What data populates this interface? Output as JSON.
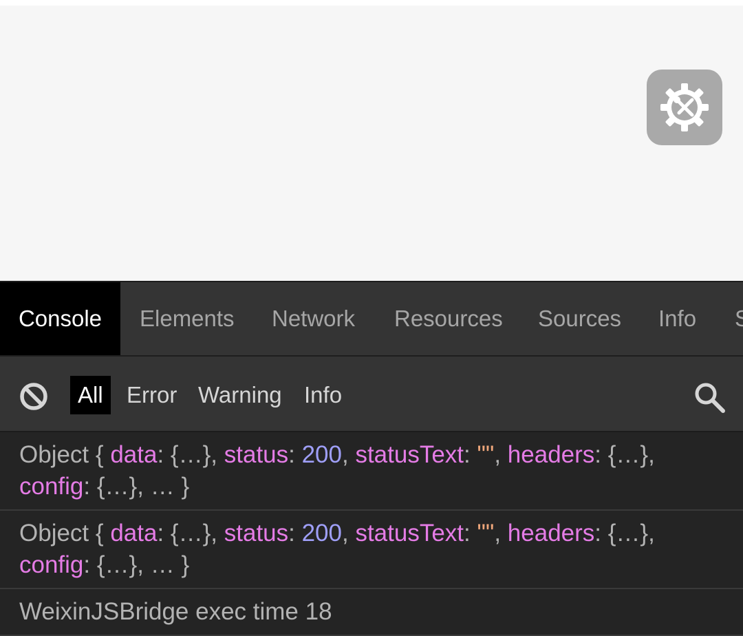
{
  "fab": {
    "icon": "settings-tools-icon",
    "color": "#a9a9a9"
  },
  "tabs": [
    {
      "label": "Console",
      "active": true
    },
    {
      "label": "Elements"
    },
    {
      "label": "Network"
    },
    {
      "label": "Resources"
    },
    {
      "label": "Sources"
    },
    {
      "label": "Info"
    },
    {
      "label": "S"
    }
  ],
  "toolbar": {
    "clear_icon": "clear-icon",
    "filters": [
      "All",
      "Error",
      "Warning",
      "Info"
    ],
    "active_filter": "All",
    "search_icon": "search-icon"
  },
  "logs": [
    {
      "object_label": "Object",
      "open_brace": "{",
      "pairs": [
        {
          "key": "data",
          "value": "{…}"
        },
        {
          "key": "status",
          "value": "200"
        },
        {
          "key": "statusText",
          "value": "\"\""
        },
        {
          "key": "headers",
          "value": "{…}"
        },
        {
          "key": "config",
          "value": "{…}"
        }
      ],
      "ellipsis": "…",
      "close_brace": "}"
    },
    {
      "object_label": "Object",
      "open_brace": "{",
      "pairs": [
        {
          "key": "data",
          "value": "{…}"
        },
        {
          "key": "status",
          "value": "200"
        },
        {
          "key": "statusText",
          "value": "\"\""
        },
        {
          "key": "headers",
          "value": "{…}"
        },
        {
          "key": "config",
          "value": "{…}"
        }
      ],
      "ellipsis": "…",
      "close_brace": "}"
    },
    {
      "text": "WeixinJSBridge exec time 18"
    }
  ],
  "colors": {
    "key": "#e57ce6",
    "number": "#9f9ff8",
    "string": "#f0a77b",
    "text": "#b3b3b3",
    "panel_bg": "#242424",
    "bar_bg": "#343434",
    "active_bg": "#000000"
  }
}
